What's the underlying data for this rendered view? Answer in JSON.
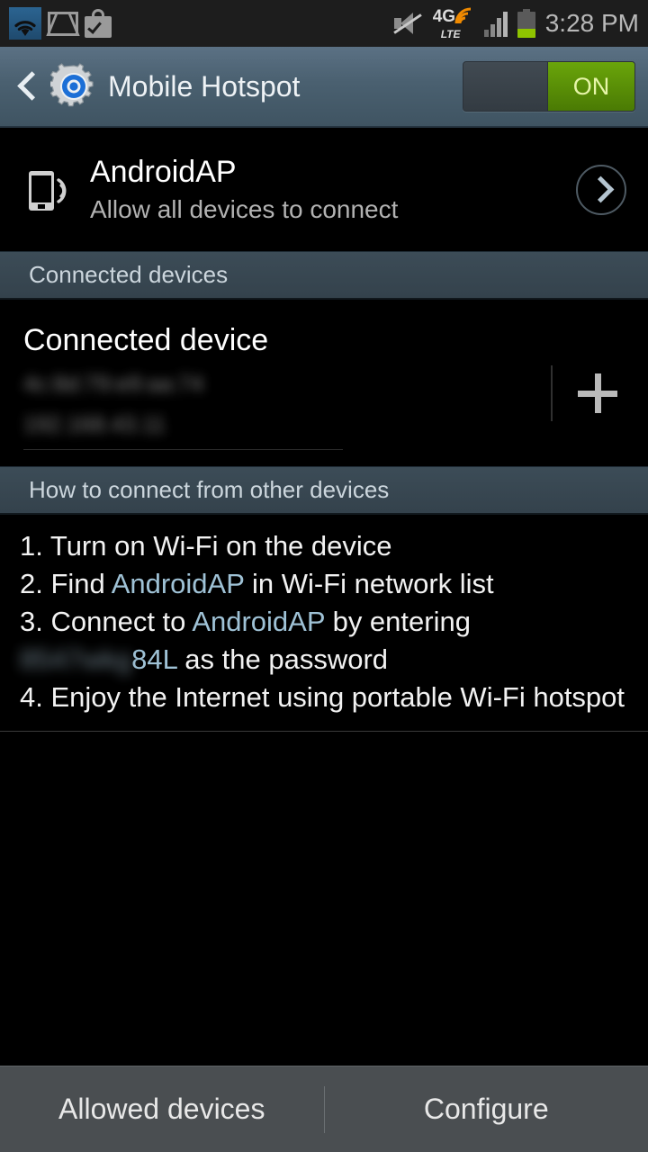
{
  "statusbar": {
    "time": "3:28 PM",
    "icons": {
      "wifi": "wifi-icon",
      "gmail": "gmail-icon",
      "playstore": "play-store-icon",
      "mute": "mute-icon",
      "network": "4g-lte-icon",
      "network_label_primary": "4G",
      "network_label_secondary": "LTE",
      "signal": "signal-bars-icon",
      "battery": "battery-icon"
    }
  },
  "actionbar": {
    "back": "back-icon",
    "app_icon": "settings-gear-icon",
    "title": "Mobile Hotspot",
    "toggle_state_label": "ON"
  },
  "ap": {
    "icon": "hotspot-device-icon",
    "name": "AndroidAP",
    "subtitle": "Allow all devices to connect",
    "arrow": "chevron-right-circle-icon"
  },
  "sections": {
    "connected_devices_header": "Connected devices",
    "howto_header": "How to connect from other devices"
  },
  "connected_device": {
    "title": "Connected device",
    "mac_address_redacted": "4c:8d:79:e9:aa:74",
    "ip_address_redacted": "192.168.43.11",
    "add_button": "add-icon"
  },
  "howto": {
    "step1": "1. Turn on Wi-Fi on the device",
    "step2_prefix": "2. Find ",
    "step2_ssid": "AndroidAP",
    "step2_suffix": " in Wi-Fi network list",
    "step3_prefix": "3. Connect to ",
    "step3_ssid": "AndroidAP",
    "step3_suffix": " by entering",
    "step3_password_redacted": "8547wkg",
    "step3_password_visible": "84L",
    "step3_password_suffix": " as the password",
    "step4": "4. Enjoy the Internet using portable Wi-Fi hotspot"
  },
  "bottombar": {
    "allowed_devices": "Allowed devices",
    "configure": "Configure"
  },
  "colors": {
    "accent_blue": "#9fc2d6",
    "toggle_on_green": "#4a7a04",
    "actionbar_blue": "#4a6070",
    "section_header": "#34424c",
    "bottom_bar": "#4a4e51"
  }
}
